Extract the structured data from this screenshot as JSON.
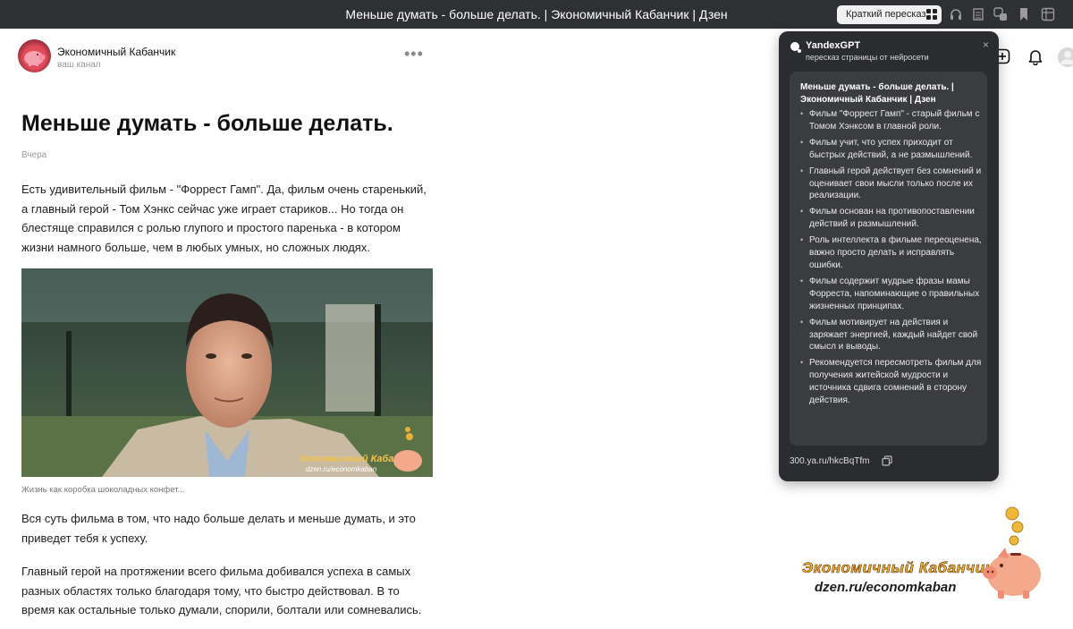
{
  "window": {
    "title": "Меньше думать - больше делать. | Экономичный Кабанчик | Дзен",
    "summary_button_label": "Краткий пересказ"
  },
  "channel": {
    "name": "Экономичный Кабанчик",
    "subtitle": "ваш канал",
    "more_label": "•••"
  },
  "article": {
    "title": "Меньше думать - больше делать.",
    "date": "Вчера",
    "paragraphs": [
      "Есть удивительный фильм - \"Форрест Гамп\". Да, фильм очень старенький, а главный герой - Том Хэнкс сейчас уже играет стариков... Но тогда он блестяще справился с ролью глупого и простого паренька - в котором жизни намного больше, чем в любых умных, но сложных людях.",
      "Вся суть фильма в том, что надо больше делать и меньше думать, и это приведет тебя к успеху.",
      "Главный герой на протяжении всего фильма добивался успеха в самых разных областях только благодаря тому, что быстро действовал. В то время как остальные только думали, спорили, болтали или сомневались."
    ],
    "image_caption": "Жизнь как коробка шоколадных конфет...",
    "image_watermark_name": "Экономичный Кабанчик",
    "image_watermark_url": "dzen.ru/economkaban"
  },
  "gpt_panel": {
    "title": "YandexGPT",
    "subtitle": "пересказ страницы от нейросети",
    "close_label": "×",
    "card_title": "Меньше думать - больше делать. | Экономичный Кабанчик | Дзен",
    "bullets": [
      "Фильм \"Форрест Гамп\" - старый фильм с Томом Хэнксом в главной роли.",
      "Фильм учит, что успех приходит от быстрых действий, а не размышлений.",
      "Главный герой действует без сомнений и оценивает свои мысли только после их реализации.",
      "Фильм основан на противопоставлении действий и размышлений.",
      "Роль интеллекта в фильме переоценена, важно просто делать и исправлять ошибки.",
      "Фильм содержит мудрые фразы мамы Форреста, напоминающие о правильных жизненных принципах.",
      "Фильм мотивирует на действия и заряжает энергией, каждый найдет свой смысл и выводы.",
      "Рекомендуется пересмотреть фильм для получения житейской мудрости и источника сдвига сомнений в сторону действия."
    ],
    "link": "300.ya.ru/hkcBqTfm"
  },
  "watermark": {
    "name": "Экономичный Кабанчик",
    "url": "dzen.ru/economkaban"
  },
  "icons": {
    "toolbar": [
      "headphones-icon",
      "reader-icon",
      "translate-icon",
      "bookmark-icon",
      "extensions-icon"
    ],
    "header": [
      "add-icon",
      "bell-icon",
      "profile-icon"
    ]
  },
  "colors": {
    "topbar": "#2f3033",
    "panel": "#2b2c2f",
    "panel_card": "#3b3c40",
    "accent_gold": "#f3b52c"
  }
}
